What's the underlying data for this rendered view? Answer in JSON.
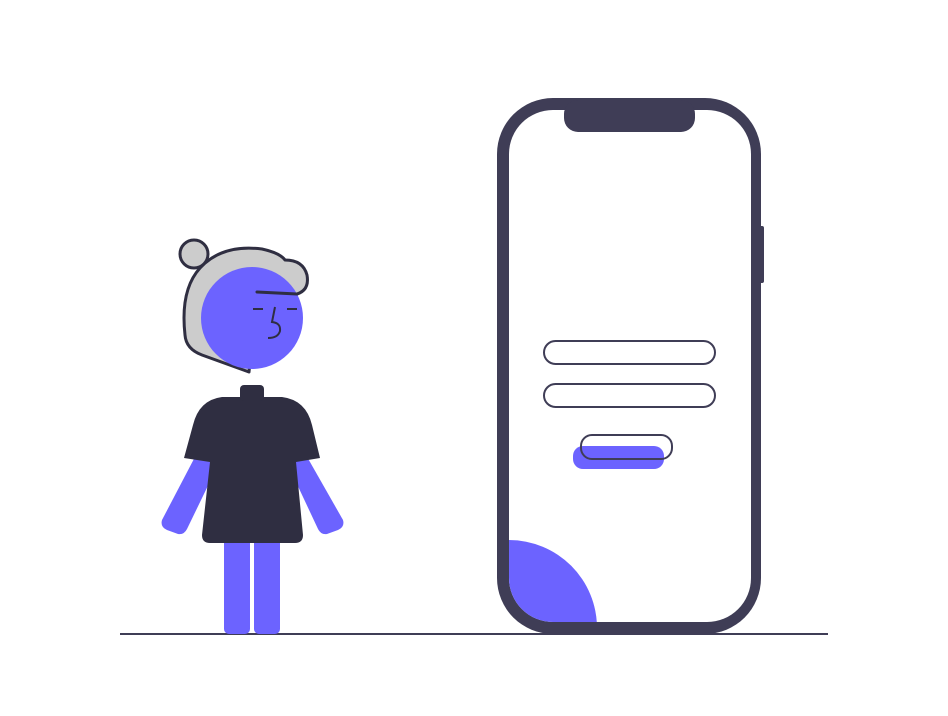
{
  "colors": {
    "accent": "#6c63ff",
    "phone_frame": "#3f3d56",
    "figure_dark": "#2f2e41",
    "hair": "#cccccc",
    "background": "#ffffff"
  },
  "icons": [
    "person-illustration",
    "smartphone-illustration",
    "login-form-illustration"
  ]
}
